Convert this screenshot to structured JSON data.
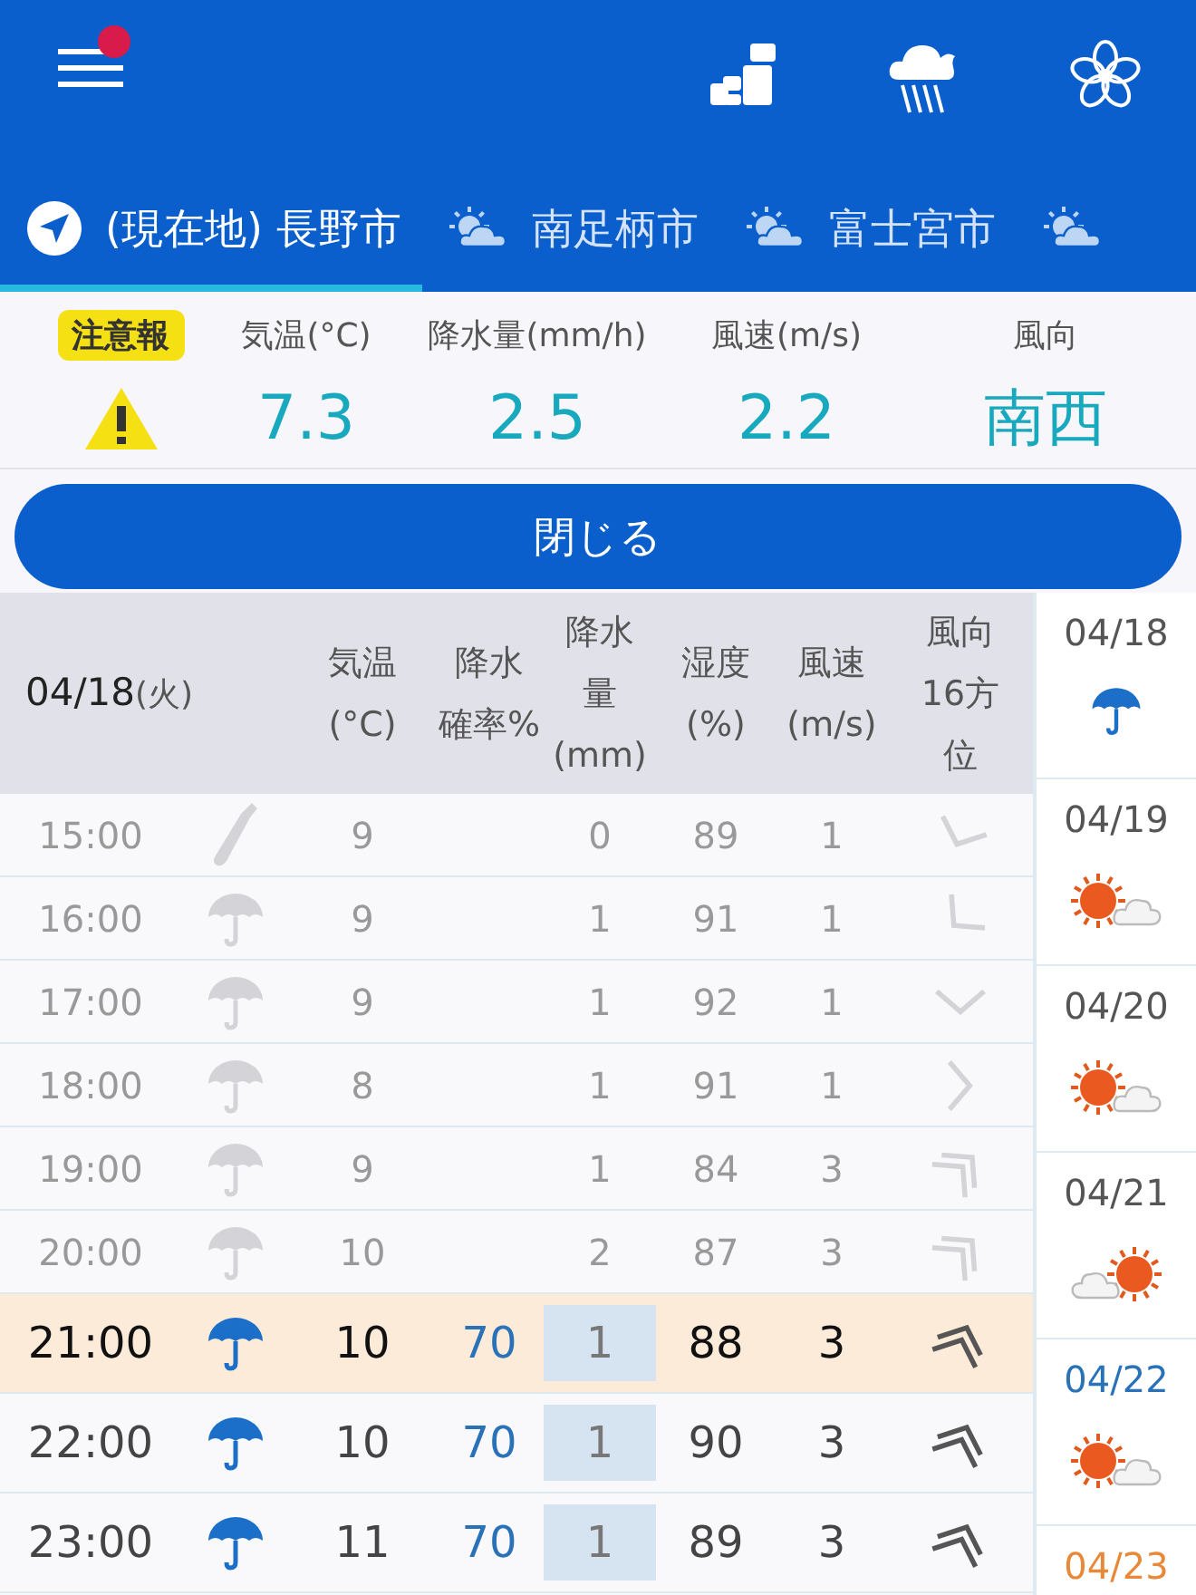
{
  "header": {
    "menu_badge": true
  },
  "tabs": [
    {
      "kind": "location",
      "label": "(現在地) 長野市",
      "selected": true
    },
    {
      "kind": "city",
      "label": "南足柄市",
      "selected": false
    },
    {
      "kind": "city",
      "label": "富士宮市",
      "selected": false
    },
    {
      "kind": "city",
      "selected": false
    }
  ],
  "current": {
    "alert": "注意報",
    "labels": [
      "気温(°C)",
      "降水量(mm/h)",
      "風速(m/s)",
      "風向"
    ],
    "values": [
      "7.3",
      "2.5",
      "2.2",
      "南西"
    ]
  },
  "close_button": "閉じる",
  "table": {
    "date": "04/18",
    "weekday": "(火)",
    "columns": [
      [
        "気温",
        "(°C)"
      ],
      [
        "降水",
        "確率%"
      ],
      [
        "降水",
        "量",
        "(mm)"
      ],
      [
        "湿度",
        "(%)"
      ],
      [
        "風速",
        "(m/s)"
      ],
      [
        "風向",
        "16方",
        "位"
      ]
    ],
    "rows": [
      {
        "time": "15:00",
        "weather_icon": {
          "kind": "closed"
        },
        "temp": "9",
        "amount": "0",
        "humidity": "89",
        "speed": "1",
        "wind_icon": {
          "kind": "ssw",
          "double": false
        },
        "past": true,
        "selected": false
      },
      {
        "time": "16:00",
        "weather_icon": {
          "kind": "umbrella"
        },
        "temp": "9",
        "amount": "1",
        "humidity": "91",
        "speed": "1",
        "wind_icon": {
          "kind": "sw",
          "double": false
        },
        "past": true,
        "selected": false
      },
      {
        "time": "17:00",
        "weather_icon": {
          "kind": "umbrella"
        },
        "temp": "9",
        "amount": "1",
        "humidity": "92",
        "speed": "1",
        "wind_icon": {
          "kind": "s",
          "double": false
        },
        "past": true,
        "selected": false
      },
      {
        "time": "18:00",
        "weather_icon": {
          "kind": "umbrella"
        },
        "temp": "8",
        "amount": "1",
        "humidity": "91",
        "speed": "1",
        "wind_icon": {
          "kind": "e",
          "double": false
        },
        "past": true,
        "selected": false
      },
      {
        "time": "19:00",
        "weather_icon": {
          "kind": "umbrella"
        },
        "temp": "9",
        "amount": "1",
        "humidity": "84",
        "speed": "3",
        "wind_icon": {
          "kind": "ne",
          "double": true
        },
        "past": true,
        "selected": false
      },
      {
        "time": "20:00",
        "weather_icon": {
          "kind": "umbrella"
        },
        "temp": "10",
        "amount": "2",
        "humidity": "87",
        "speed": "3",
        "wind_icon": {
          "kind": "ne",
          "double": true
        },
        "past": true,
        "selected": false
      },
      {
        "time": "21:00",
        "weather_icon": {
          "kind": "umbrella"
        },
        "temp": "10",
        "probability": "70",
        "amount": "1",
        "humidity": "88",
        "speed": "3",
        "wind_icon": {
          "kind": "nne",
          "double": true
        },
        "past": false,
        "selected": true
      },
      {
        "time": "22:00",
        "weather_icon": {
          "kind": "umbrella"
        },
        "temp": "10",
        "probability": "70",
        "amount": "1",
        "humidity": "90",
        "speed": "3",
        "wind_icon": {
          "kind": "nne",
          "double": true
        },
        "past": false,
        "selected": false
      },
      {
        "time": "23:00",
        "weather_icon": {
          "kind": "umbrella"
        },
        "temp": "11",
        "probability": "70",
        "amount": "1",
        "humidity": "89",
        "speed": "3",
        "wind_icon": {
          "kind": "nne",
          "double": true
        },
        "past": false,
        "selected": false
      }
    ]
  },
  "days": [
    {
      "date": "04/18",
      "kind": "weekday",
      "icon": {
        "kind": "umbrella"
      }
    },
    {
      "date": "04/19",
      "kind": "weekday",
      "icon": {
        "kind": "suncloud"
      }
    },
    {
      "date": "04/20",
      "kind": "weekday",
      "icon": {
        "kind": "suncloud"
      }
    },
    {
      "date": "04/21",
      "kind": "weekday",
      "icon": {
        "kind": "cloudsun"
      }
    },
    {
      "date": "04/22",
      "kind": "saturday",
      "icon": {
        "kind": "suncloud"
      }
    },
    {
      "date": "04/23",
      "kind": "sunday"
    }
  ]
}
